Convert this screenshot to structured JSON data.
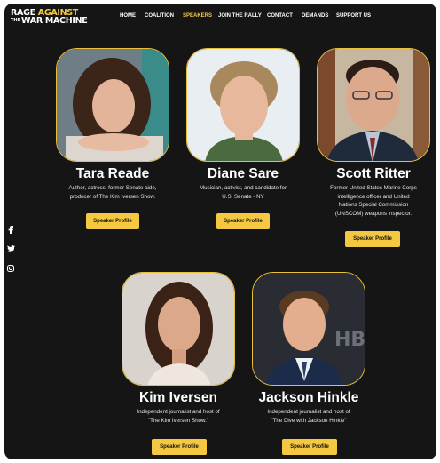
{
  "logo": {
    "line1a": "RAGE ",
    "line1b": "AGAINST",
    "line2a": "THE",
    "line2b": "WAR MACHINE"
  },
  "nav": {
    "items": [
      {
        "label": "HOME"
      },
      {
        "label": "COALITION"
      },
      {
        "label": "SPEAKERS",
        "active": true
      },
      {
        "label": "JOIN THE RALLY"
      },
      {
        "label": "CONTACT"
      },
      {
        "label": "DEMANDS"
      },
      {
        "label": "SUPPORT US"
      }
    ]
  },
  "social": [
    "facebook-icon",
    "twitter-icon",
    "instagram-icon"
  ],
  "speakers": [
    {
      "name": "Tara Reade",
      "desc": [
        "Author, actress, former Senate aide,",
        "producer of The Kim Iversen Show."
      ],
      "button": "Speaker Profile"
    },
    {
      "name": "Diane Sare",
      "desc": [
        "Musician, activist, and candidate for",
        "U.S. Senate - NY"
      ],
      "button": "Speaker Profile"
    },
    {
      "name": "Scott Ritter",
      "desc": [
        "Former United States Marine Corps",
        "intelligence officer and United",
        "Nations Special Commission",
        "(UNSCOM) weapons inspector."
      ],
      "button": "Speaker Profile"
    },
    {
      "name": "Kim Iversen",
      "desc": [
        "Independent journalist and host of",
        "\"The Kim Iversen Show.\""
      ],
      "button": "Speaker Profile"
    },
    {
      "name": "Jackson Hinkle",
      "desc": [
        "Independent journalist and host of",
        "\"The Dive with Jackson Hinkle\""
      ],
      "button": "Speaker Profile"
    }
  ],
  "colors": {
    "background": "#151515",
    "accent": "#f2c94c",
    "button": "#f5c842",
    "text": "#ffffff"
  }
}
